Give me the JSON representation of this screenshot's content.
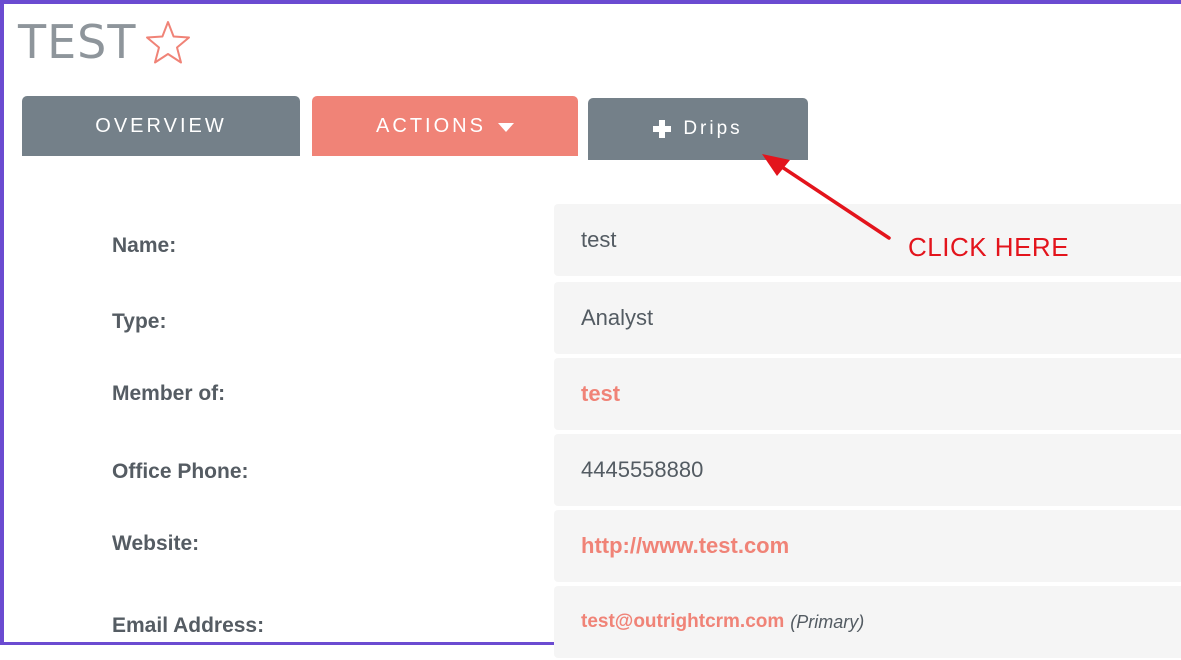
{
  "header": {
    "title": "TEST",
    "favorite_icon": "star-outline-icon",
    "favorite_color": "#f08377"
  },
  "tabs": {
    "overview_label": "OVERVIEW",
    "actions_label": "ACTIONS",
    "actions_icon": "caret-down-icon",
    "drips_label": "Drips",
    "drips_icon": "plus-icon"
  },
  "fields": [
    {
      "label": "Name:",
      "value": "test"
    },
    {
      "label": "Type:",
      "value": "Analyst"
    },
    {
      "label": "Member of:",
      "value": "test"
    },
    {
      "label": "Office Phone:",
      "value": "4445558880"
    },
    {
      "label": "Website:",
      "value": "http://www.test.com"
    },
    {
      "label": "Email Address:",
      "value": "test@outrightcrm.com",
      "note": "(Primary)"
    }
  ],
  "annotation": {
    "text": "CLICK HERE",
    "color": "#e3141c"
  },
  "colors": {
    "tab_gray": "#748089",
    "tab_accent": "#f08377",
    "link": "#f08377",
    "frame_border": "#6b4bd1"
  }
}
